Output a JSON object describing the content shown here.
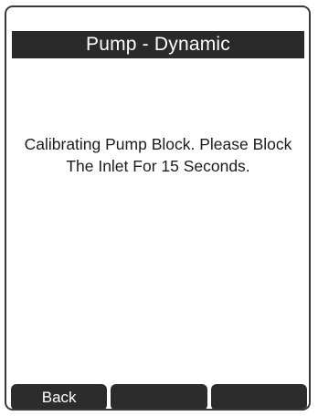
{
  "screen": {
    "title": "Pump - Dynamic",
    "message_lines": [
      "Calibrating Pump Block. Please Block",
      "The Inlet For 15 Seconds."
    ]
  },
  "softkeys": {
    "left": "Back",
    "middle": "",
    "right": ""
  },
  "colors": {
    "title_bar": "#2a2a2a",
    "softkey": "#2c2c2c",
    "text": "#1c1c1c"
  }
}
